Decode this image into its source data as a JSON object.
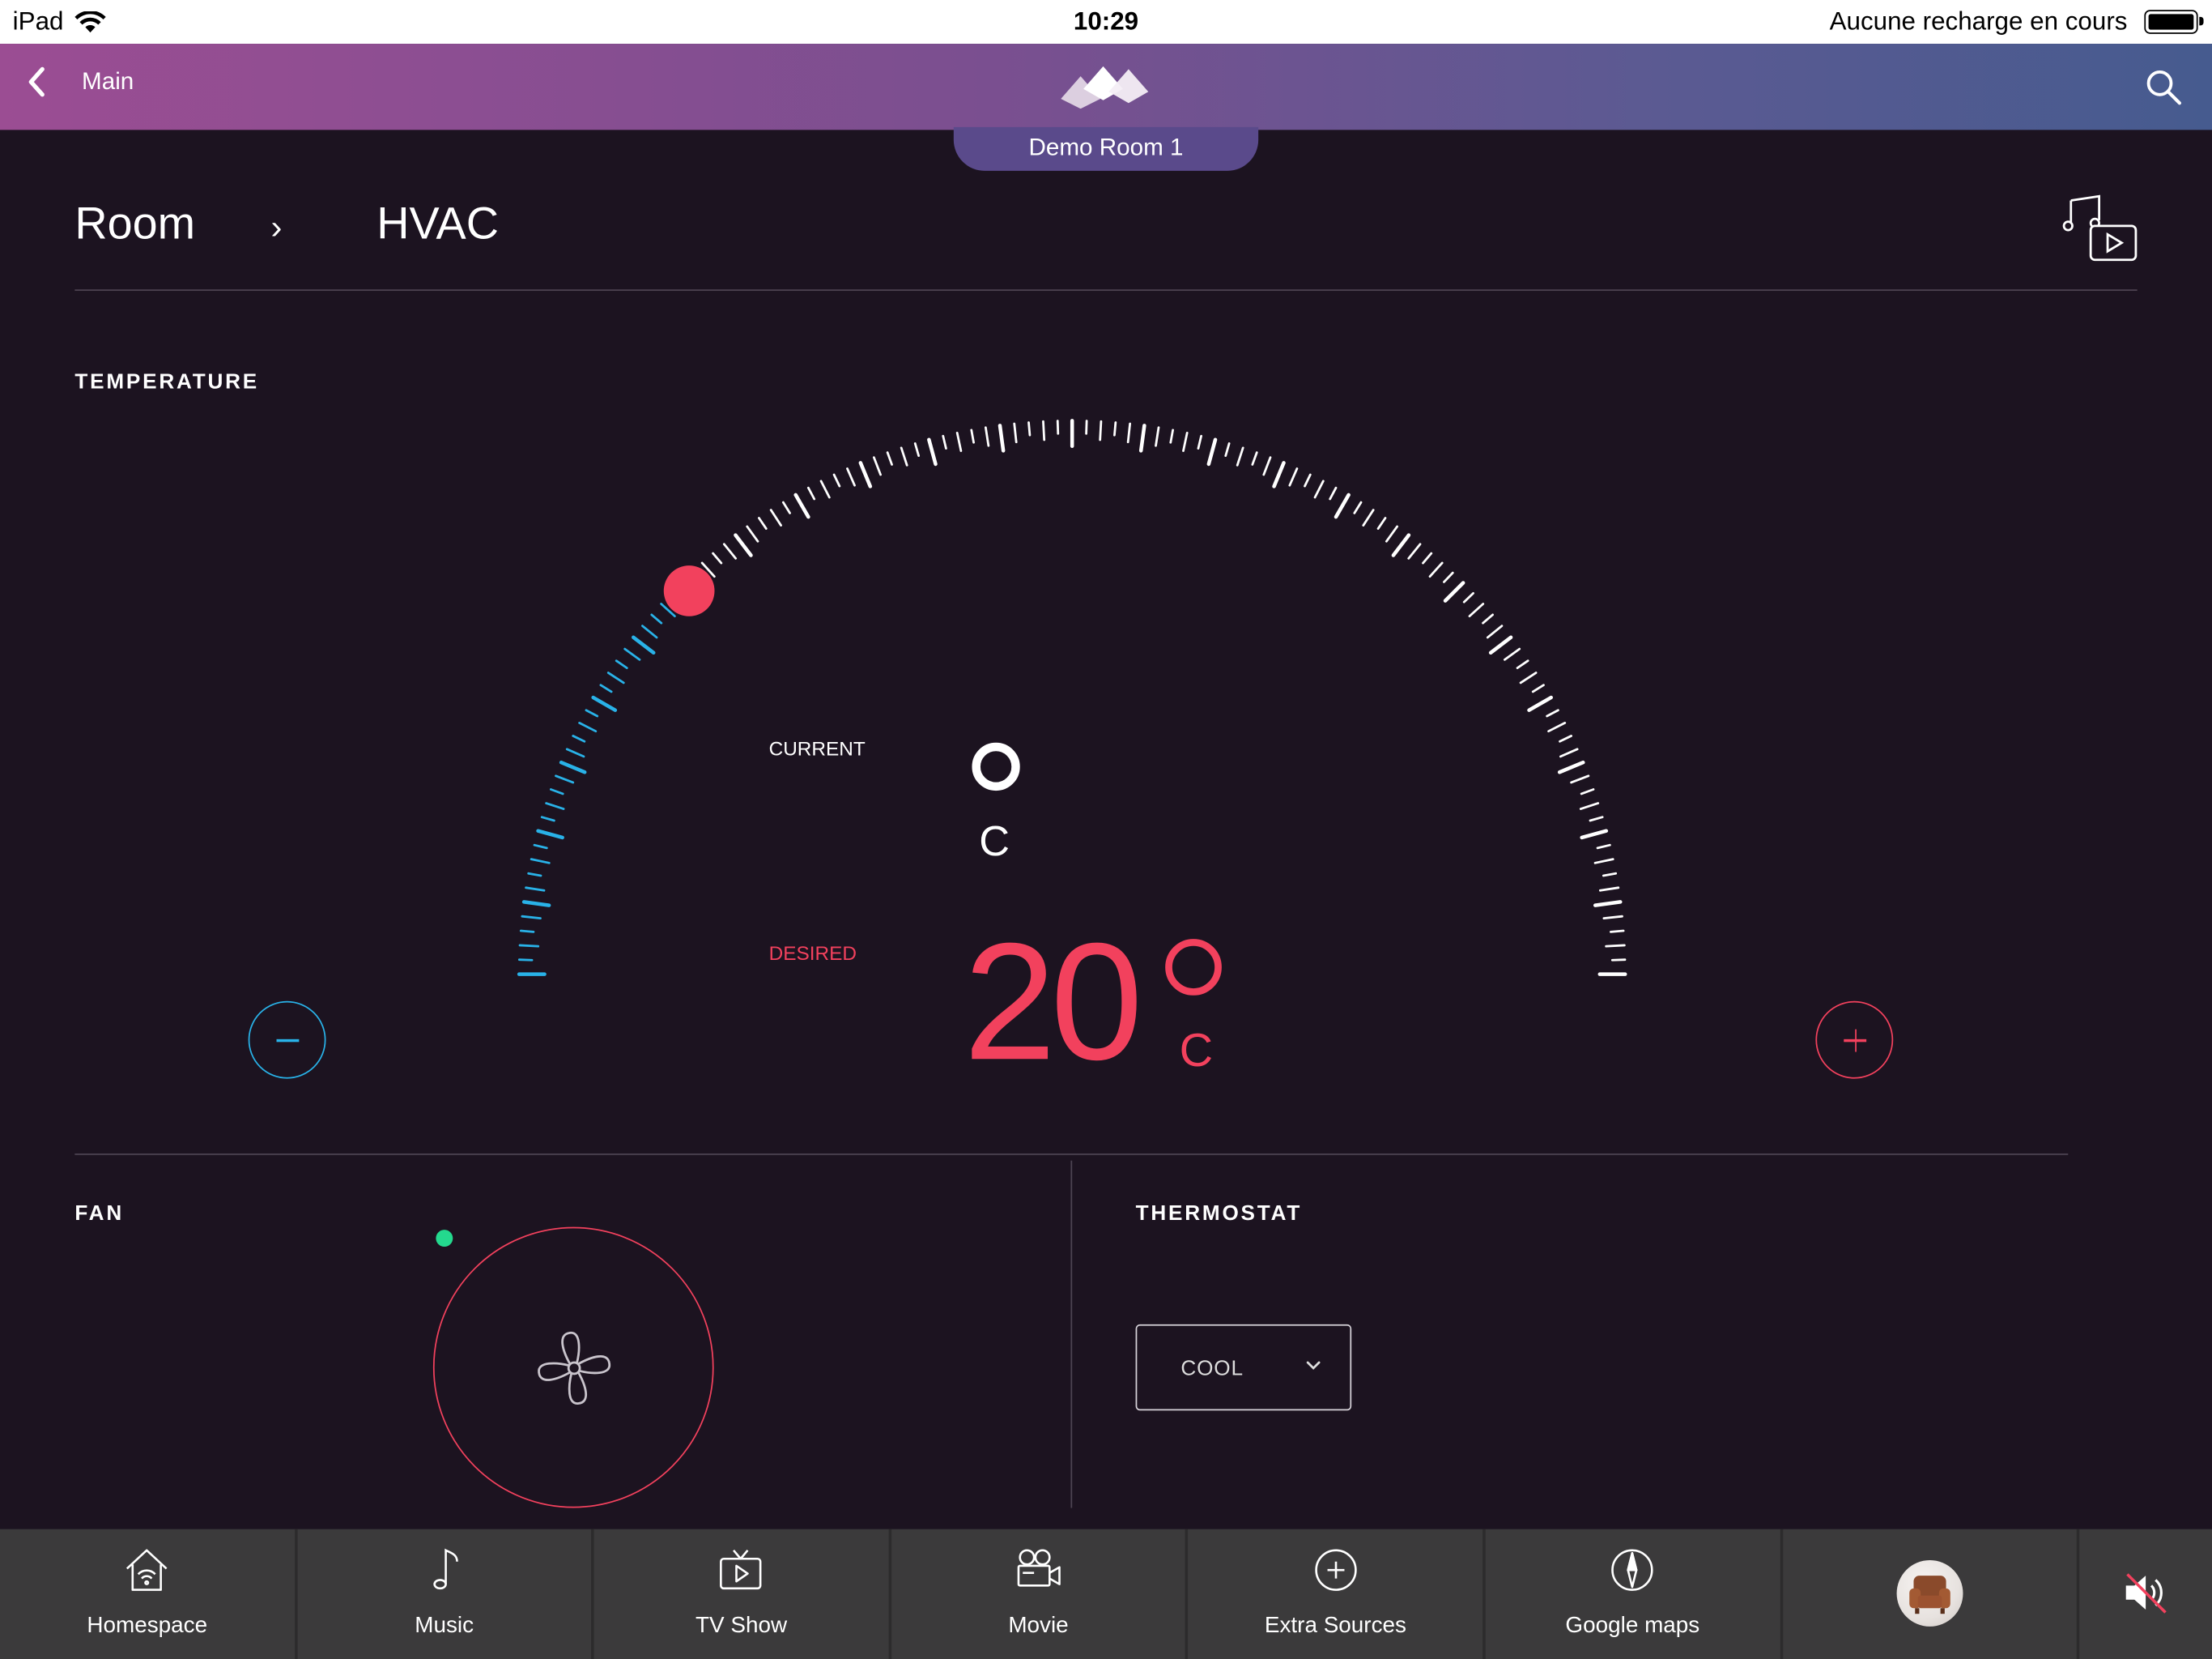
{
  "status_bar": {
    "device": "iPad",
    "time": "10:29",
    "battery_text": "Aucune recharge en cours"
  },
  "header": {
    "back_label": "Main",
    "room_name": "Demo Room 1"
  },
  "breadcrumb": {
    "items": [
      "Room",
      "HVAC"
    ],
    "separator": "›"
  },
  "temperature": {
    "section_title": "TEMPERATURE",
    "current_label": "CURRENT",
    "current_unit": "C",
    "desired_label": "DESIRED",
    "desired_value": "20",
    "desired_unit": "C",
    "dial_setpoint_fraction": 0.25
  },
  "fan": {
    "section_title": "FAN",
    "status": "on"
  },
  "thermostat": {
    "section_title": "THERMOSTAT",
    "mode": "COOL"
  },
  "dock": {
    "items": [
      {
        "label": "Homespace",
        "icon": "home-icon"
      },
      {
        "label": "Music",
        "icon": "music-note-icon"
      },
      {
        "label": "TV Show",
        "icon": "tv-icon"
      },
      {
        "label": "Movie",
        "icon": "movie-camera-icon"
      },
      {
        "label": "Extra Sources",
        "icon": "add-circle-icon"
      },
      {
        "label": "Google maps",
        "icon": "compass-icon"
      }
    ]
  },
  "colors": {
    "accent_hot": "#f2415d",
    "accent_cold": "#29b2e8",
    "fan_on": "#24d98e",
    "background": "#1c1320"
  }
}
